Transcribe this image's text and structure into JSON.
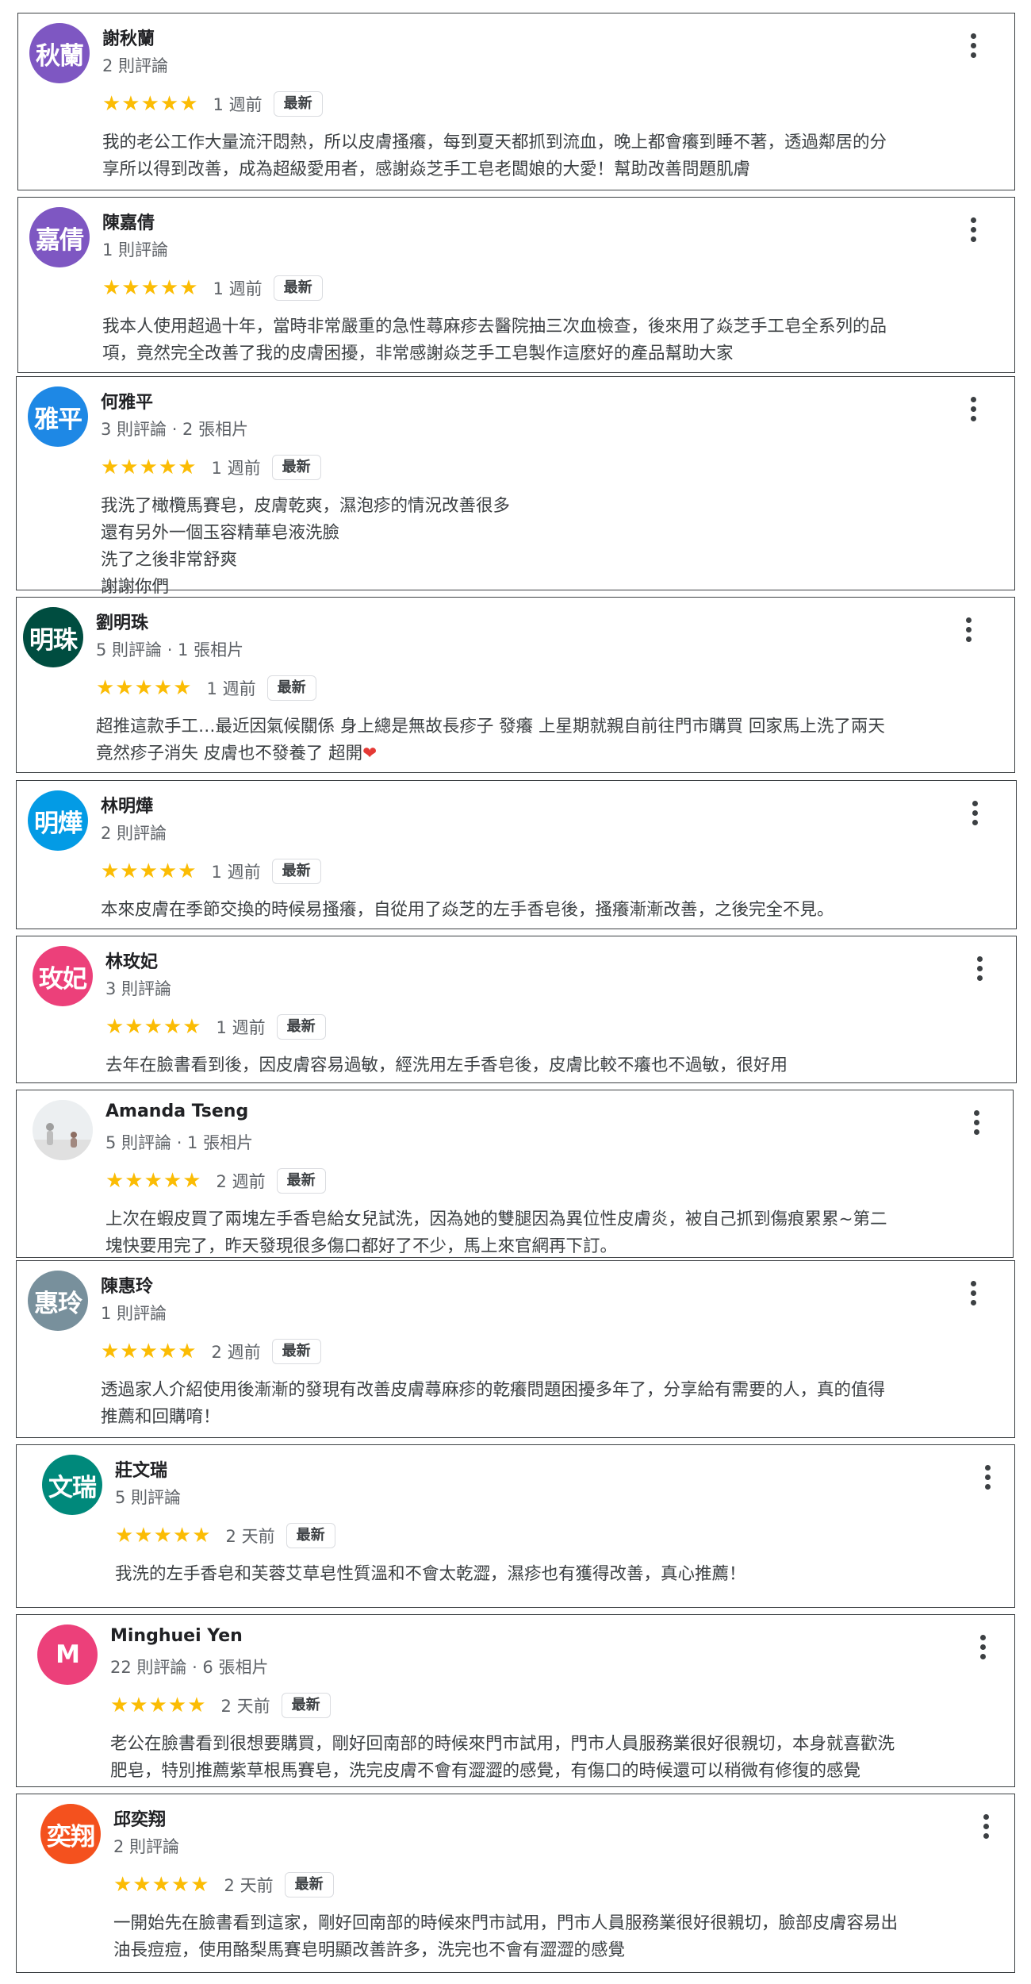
{
  "reviews": [
    {
      "avatar_text": "秋蘭",
      "avatar_color": "#7e57c2",
      "name": "謝秋蘭",
      "meta": "2 則評論",
      "stars": "★★★★★",
      "when": "1 週前",
      "badge": "最新",
      "text": "我的老公工作大量流汗悶熱，所以皮膚搔癢，每到夏天都抓到流血，晚上都會癢到睡不著，透過鄰居的分\n享所以得到改善，成為超級愛用者，感謝焱芝手工皂老闆娘的大愛！幫助改善問題肌膚"
    },
    {
      "avatar_text": "嘉倩",
      "avatar_color": "#7e57c2",
      "name": "陳嘉倩",
      "meta": "1 則評論",
      "stars": "★★★★★",
      "when": "1 週前",
      "badge": "最新",
      "text": "我本人使用超過十年，當時非常嚴重的急性蕁麻疹去醫院抽三次血檢查，後來用了焱芝手工皂全系列的品\n項，竟然完全改善了我的皮膚困擾，非常感謝焱芝手工皂製作這麼好的產品幫助大家"
    },
    {
      "avatar_text": "雅平",
      "avatar_color": "#1e88e5",
      "name": "何雅平",
      "meta": "3 則評論 · 2 張相片",
      "stars": "★★★★★",
      "when": "1 週前",
      "badge": "最新",
      "text": "我洗了橄欖馬賽皂，皮膚乾爽，濕泡疹的情況改善很多\n還有另外一個玉容精華皂液洗臉\n洗了之後非常舒爽\n謝謝你們"
    },
    {
      "avatar_text": "明珠",
      "avatar_color": "#004d40",
      "name": "劉明珠",
      "meta": "5 則評論 · 1 張相片",
      "stars": "★★★★★",
      "when": "1 週前",
      "badge": "最新",
      "text": "超推這款手工…最近因氣候關係 身上總是無故長疹子 發癢  上星期就親自前往門市購買 回家馬上洗了兩天\n竟然疹子消失 皮膚也不發養了 超開",
      "emoji": "❤"
    },
    {
      "avatar_text": "明燁",
      "avatar_color": "#039be5",
      "name": "林明燁",
      "meta": "2 則評論",
      "stars": "★★★★★",
      "when": "1 週前",
      "badge": "最新",
      "text": "本來皮膚在季節交換的時候易搔癢，自從用了焱芝的左手香皂後，搔癢漸漸改善，之後完全不見。"
    },
    {
      "avatar_text": "玫妃",
      "avatar_color": "#ec407a",
      "name": "林玫妃",
      "meta": "3 則評論",
      "stars": "★★★★★",
      "when": "1 週前",
      "badge": "最新",
      "text": "去年在臉書看到後，因皮膚容易過敏，經洗用左手香皂後，皮膚比較不癢也不過敏，很好用"
    },
    {
      "avatar_text": "",
      "avatar_color": "#f1f3f4",
      "avatar_photo": true,
      "name": "Amanda Tseng",
      "meta": "5 則評論 · 1 張相片",
      "stars": "★★★★★",
      "when": "2 週前",
      "badge": "最新",
      "text": "上次在蝦皮買了兩塊左手香皂給女兒試洗，因為她的雙腿因為異位性皮膚炎，被自己抓到傷痕累累~第二\n塊快要用完了，昨天發現很多傷口都好了不少，馬上來官網再下訂。"
    },
    {
      "avatar_text": "惠玲",
      "avatar_color": "#78909c",
      "name": "陳惠玲",
      "meta": "1 則評論",
      "stars": "★★★★★",
      "when": "2 週前",
      "badge": "最新",
      "text": "透過家人介紹使用後漸漸的發現有改善皮膚蕁麻疹的乾癢問題困擾多年了，分享給有需要的人，真的值得\n推薦和回購唷！"
    },
    {
      "avatar_text": "文瑞",
      "avatar_color": "#00897b",
      "name": "莊文瑞",
      "meta": "5 則評論",
      "stars": "★★★★★",
      "when": "2 天前",
      "badge": "最新",
      "text": "我洗的左手香皂和芙蓉艾草皂性質溫和不會太乾澀，濕疹也有獲得改善，真心推薦！"
    },
    {
      "avatar_text": "M",
      "avatar_color": "#ec407a",
      "name": "Minghuei Yen",
      "meta": "22 則評論 · 6 張相片",
      "stars": "★★★★★",
      "when": "2 天前",
      "badge": "最新",
      "text": "老公在臉書看到很想要購買，剛好回南部的時候來門市試用，門市人員服務業很好很親切，本身就喜歡洗\n肥皂，特別推薦紫草根馬賽皂，洗完皮膚不會有澀澀的感覺，有傷口的時候還可以稍微有修復的感覺"
    },
    {
      "avatar_text": "奕翔",
      "avatar_color": "#f4511e",
      "name": "邱奕翔",
      "meta": "2 則評論",
      "stars": "★★★★★",
      "when": "2 天前",
      "badge": "最新",
      "text": "一開始先在臉書看到這家，剛好回南部的時候來門市試用，門市人員服務業很好很親切，臉部皮膚容易出\n油長痘痘，使用酪梨馬賽皂明顯改善許多，洗完也不會有澀澀的感覺"
    }
  ]
}
